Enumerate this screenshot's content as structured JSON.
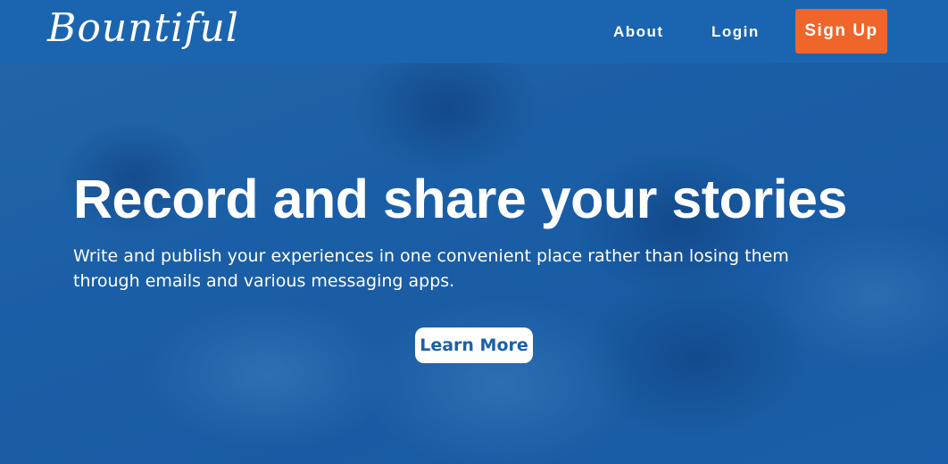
{
  "brand": {
    "name": "Bountiful"
  },
  "nav": {
    "about_label": "About",
    "login_label": "Login",
    "signup_label": "Sign Up"
  },
  "hero": {
    "title": "Record and share your stories",
    "subtitle": "Write and publish your experiences in one convenient place rather than losing them through emails and various messaging apps.",
    "cta_label": "Learn More"
  },
  "colors": {
    "nav_bg": "#1b65b0",
    "signup_bg": "#f0652a",
    "hero_overlay": "#1b5fa8",
    "cta_text": "#1b5fa8"
  }
}
